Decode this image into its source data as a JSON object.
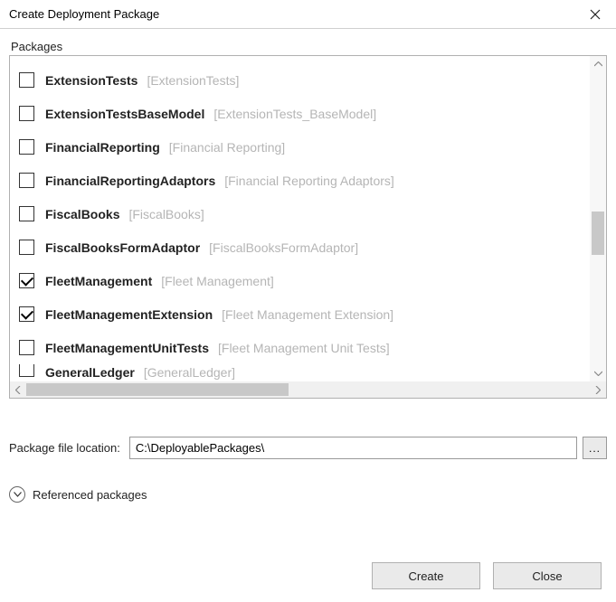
{
  "window": {
    "title": "Create Deployment Package"
  },
  "packages_label": "Packages",
  "packages": [
    {
      "name": "ExtensionTests",
      "desc": "[ExtensionTests]",
      "checked": false
    },
    {
      "name": "ExtensionTestsBaseModel",
      "desc": "[ExtensionTests_BaseModel]",
      "checked": false
    },
    {
      "name": "FinancialReporting",
      "desc": "[Financial Reporting]",
      "checked": false
    },
    {
      "name": "FinancialReportingAdaptors",
      "desc": "[Financial Reporting Adaptors]",
      "checked": false
    },
    {
      "name": "FiscalBooks",
      "desc": "[FiscalBooks]",
      "checked": false
    },
    {
      "name": "FiscalBooksFormAdaptor",
      "desc": "[FiscalBooksFormAdaptor]",
      "checked": false
    },
    {
      "name": "FleetManagement",
      "desc": "[Fleet Management]",
      "checked": true
    },
    {
      "name": "FleetManagementExtension",
      "desc": "[Fleet Management Extension]",
      "checked": true
    },
    {
      "name": "FleetManagementUnitTests",
      "desc": "[Fleet Management Unit Tests]",
      "checked": false
    }
  ],
  "cutoff": {
    "name": "GeneralLedger",
    "desc": "[GeneralLedger]"
  },
  "location": {
    "label": "Package file location:",
    "value": "C:\\DeployablePackages\\",
    "browse": "..."
  },
  "referenced": {
    "label": "Referenced packages"
  },
  "buttons": {
    "create": "Create",
    "close": "Close"
  }
}
